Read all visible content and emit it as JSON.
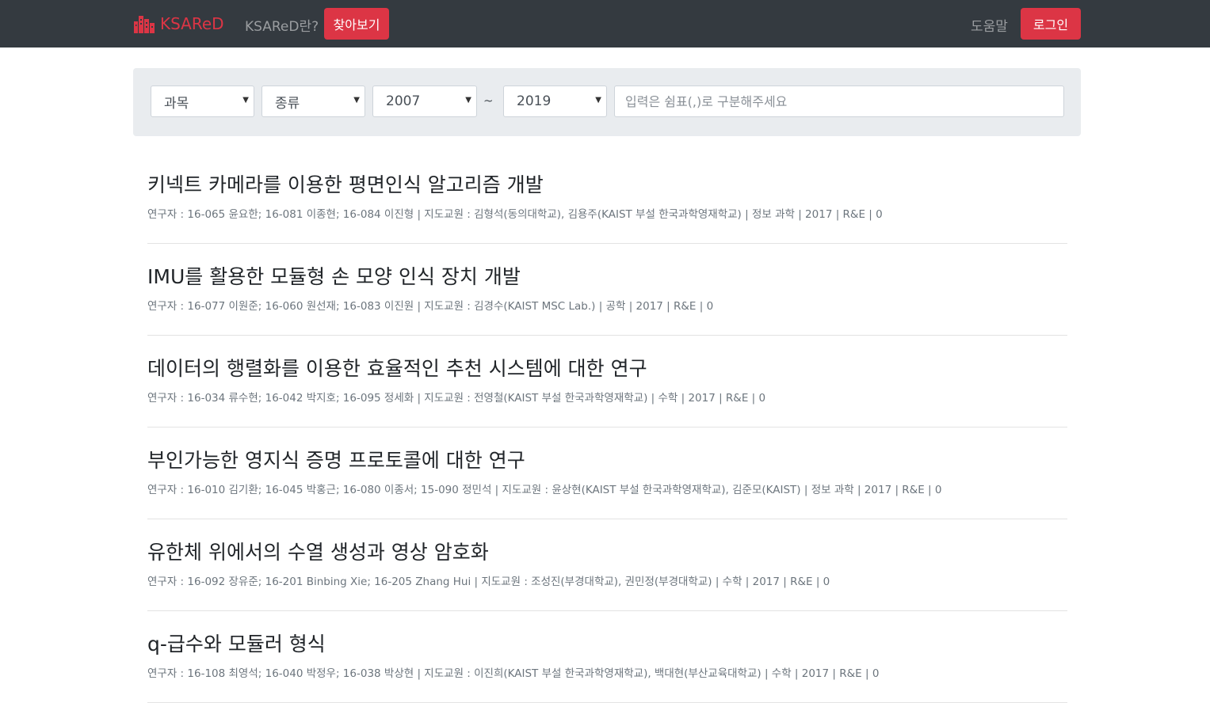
{
  "navbar": {
    "brand": "KSAReD",
    "about_label": "KSAReD란?",
    "browse_label": "찾아보기",
    "help_label": "도움말",
    "login_label": "로그인"
  },
  "filters": {
    "subject": "과목",
    "type": "종류",
    "year_from": "2007",
    "tilde": "~",
    "year_to": "2019",
    "search_placeholder": "입력은 쉼표(,)로 구분해주세요"
  },
  "results": [
    {
      "title": "키넥트 카메라를 이용한 평면인식 알고리즘 개발",
      "meta": "연구자 : 16-065 윤요한; 16-081 이종현; 16-084 이진형 | 지도교원 : 김형석(동의대학교), 김용주(KAIST 부설 한국과학영재학교) | 정보 과학 | 2017 | R&E | 0"
    },
    {
      "title": "IMU를 활용한 모듈형 손 모양 인식 장치 개발",
      "meta": "연구자 : 16-077 이원준; 16-060 원선재; 16-083 이진원 | 지도교원 : 김경수(KAIST MSC Lab.) | 공학 | 2017 | R&E | 0"
    },
    {
      "title": "데이터의 행렬화를 이용한 효율적인 추천 시스템에 대한 연구",
      "meta": "연구자 : 16-034 류수현; 16-042 박지호; 16-095 정세화 | 지도교원 : 전영철(KAIST 부설 한국과학영재학교) | 수학 | 2017 | R&E | 0"
    },
    {
      "title": "부인가능한 영지식 증명 프로토콜에 대한 연구",
      "meta": "연구자 : 16-010 김기환; 16-045 박홍근; 16-080 이종서; 15-090 정민석 | 지도교원 : 윤상현(KAIST 부설 한국과학영재학교), 김준모(KAIST) | 정보 과학 | 2017 | R&E | 0"
    },
    {
      "title": "유한체 위에서의 수열 생성과 영상 암호화",
      "meta": "연구자 : 16-092 장유준; 16-201 Binbing Xie; 16-205 Zhang Hui | 지도교원 : 조성진(부경대학교), 권민정(부경대학교) | 수학 | 2017 | R&E | 0"
    },
    {
      "title": "q-급수와 모듈러 형식",
      "meta": "연구자 : 16-108 최영석; 16-040 박정우; 16-038 박상현 | 지도교원 : 이진희(KAIST 부설 한국과학영재학교), 백대현(부산교육대학교) | 수학 | 2017 | R&E | 0"
    }
  ]
}
